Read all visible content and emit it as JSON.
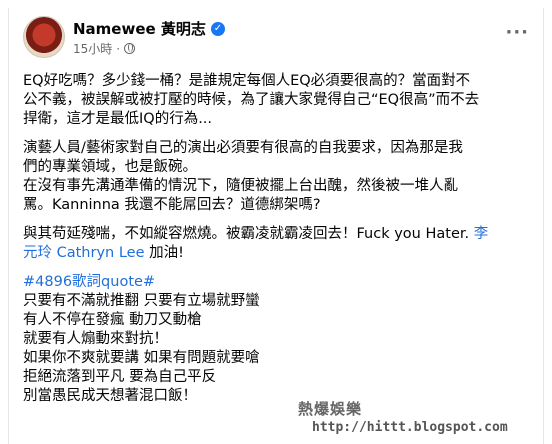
{
  "post": {
    "author": "Namewee 黃明志",
    "time": "15小時",
    "time_separator": "·"
  },
  "paragraphs": {
    "p1": [
      "EQ好吃嗎？多少錢一桶？是誰規定每個人EQ必須要很高的？當面對不",
      "公不義，被誤解或被打壓的時候，為了讓大家覺得自己“EQ很高”而不去",
      "捍衛，這才是最低IQ的行為..."
    ],
    "p2": [
      "演藝人員/藝術家對自己的演出必須要有很高的自我要求，因為那是我",
      "們的專業領域，也是飯碗。"
    ],
    "p3": [
      "在沒有事先溝通準備的情況下，隨便被擺上台出醜，然後被一堆人亂",
      "罵。Kanninna 我還不能屌回去？道德綁架嗎?"
    ],
    "p4": {
      "line1_text": "與其苟延殘喘，不如縱容燃燒。被霸凌就霸凌回去！Fuck you Hater. ",
      "line1_link": "李",
      "line2_link": "元玲 Cathryn Lee",
      "line2_text": " 加油!"
    },
    "hashtag": "#4896歌詞quote#",
    "lyrics": [
      "只要有不滿就推翻 只要有立場就野蠻",
      "有人不停在發瘋 動刀又動槍",
      "就要有人煽動來對抗！",
      "如果你不爽就要講 如果有問題就要嗆",
      "拒絕流落到平凡 要為自己平反",
      "別當愚民成天想著混口飯！"
    ]
  },
  "watermark": {
    "title": "熱爆娛樂",
    "url": "http://hittt.blogspot.com"
  },
  "colors": {
    "link": "#216fdb",
    "verified": "#1877f2",
    "meta": "#65676b"
  }
}
